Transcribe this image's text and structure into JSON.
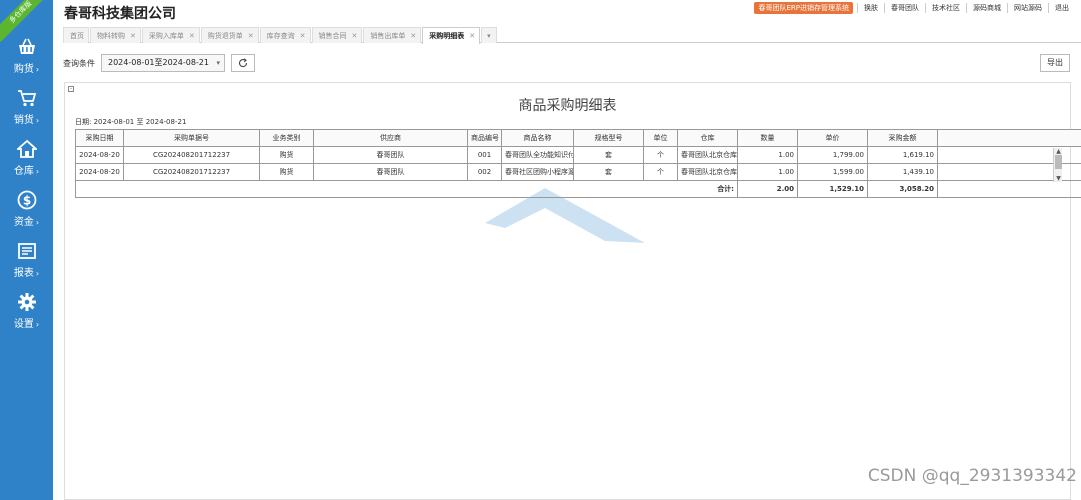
{
  "ribbon": "多仓库版",
  "company": "春哥科技集团公司",
  "sys_badge": "春哥团队ERP进销存管理系统",
  "top_links": [
    "换肤",
    "春哥团队",
    "技术社区",
    "源码商城",
    "网站源码",
    "退出"
  ],
  "sidebar": [
    {
      "label": "购货",
      "icon": "basket-icon"
    },
    {
      "label": "销货",
      "icon": "cart-icon"
    },
    {
      "label": "仓库",
      "icon": "home-icon"
    },
    {
      "label": "资金",
      "icon": "dollar-icon"
    },
    {
      "label": "报表",
      "icon": "report-icon"
    },
    {
      "label": "设置",
      "icon": "gear-icon"
    }
  ],
  "tabs": [
    {
      "label": "首页",
      "closable": false
    },
    {
      "label": "物料转购",
      "closable": true
    },
    {
      "label": "采购入库单",
      "closable": true
    },
    {
      "label": "购货退货单",
      "closable": true
    },
    {
      "label": "库存查询",
      "closable": true
    },
    {
      "label": "销售合同",
      "closable": true
    },
    {
      "label": "销售出库单",
      "closable": true
    },
    {
      "label": "采购明细表",
      "closable": true,
      "active": true
    }
  ],
  "query": {
    "label": "查询条件",
    "range": "2024-08-01至2024-08-21",
    "export": "导出"
  },
  "report": {
    "title": "商品采购明细表",
    "date_line": "日期: 2024-08-01 至 2024-08-21",
    "columns": [
      "采购日期",
      "采购单据号",
      "业务类别",
      "供应商",
      "商品编号",
      "商品名称",
      "规格型号",
      "单位",
      "仓库",
      "数量",
      "单价",
      "采购金额",
      ""
    ],
    "rows": [
      [
        "2024-08-20",
        "CG202408201712237",
        "购货",
        "春哥团队",
        "001",
        "春哥团队全功能知识付",
        "套",
        "个",
        "春哥团队北京仓库",
        "1.00",
        "1,799.00",
        "1,619.10",
        ""
      ],
      [
        "2024-08-20",
        "CG202408201712237",
        "购货",
        "春哥团队",
        "002",
        "春哥社区团购小程序源",
        "套",
        "个",
        "春哥团队北京仓库",
        "1.00",
        "1,599.00",
        "1,439.10",
        ""
      ]
    ],
    "total": {
      "label": "合计:",
      "qty": "2.00",
      "price": "1,529.10",
      "amount": "3,058.20"
    }
  },
  "footer_watermark": "CSDN @qq_2931393342",
  "colors": {
    "sidebar": "#2f82c8",
    "ribbon": "#5cb531",
    "badge": "#e8743b"
  }
}
